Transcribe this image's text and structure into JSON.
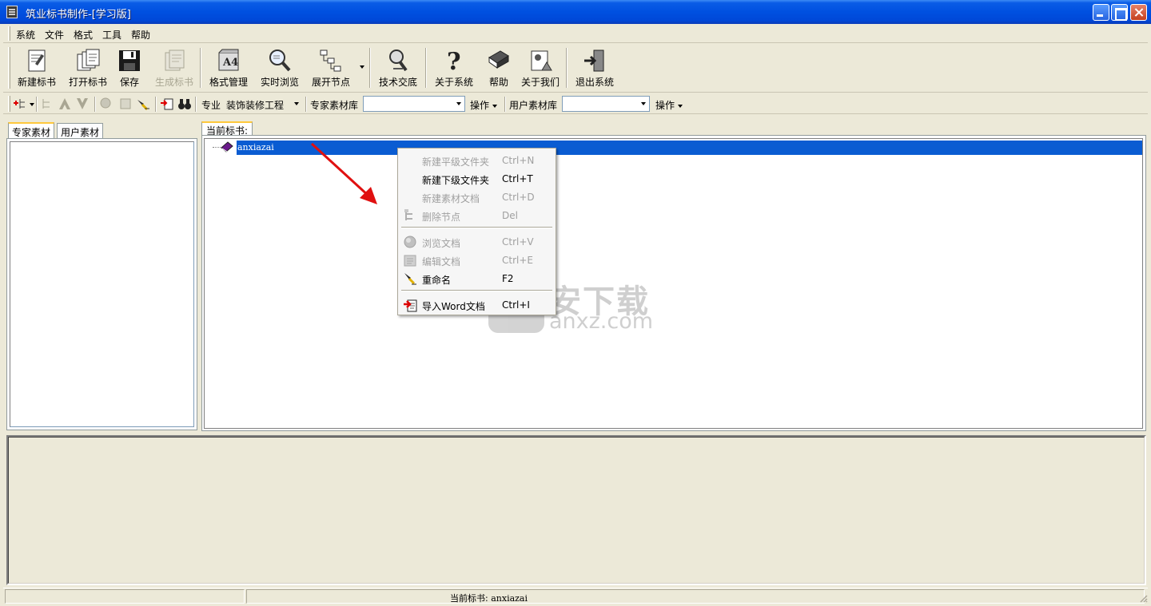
{
  "window": {
    "title": "筑业标书制作-[学习版]"
  },
  "menubar": {
    "items": [
      "系统",
      "文件",
      "格式",
      "工具",
      "帮助"
    ]
  },
  "toolbar": {
    "buttons": [
      {
        "label": "新建标书",
        "icon": "new-document-icon",
        "enabled": true
      },
      {
        "label": "打开标书",
        "icon": "open-documents-icon",
        "enabled": true
      },
      {
        "label": "保存",
        "icon": "save-floppy-icon",
        "enabled": true
      },
      {
        "label": "生成标书",
        "icon": "generate-document-icon",
        "enabled": false
      },
      {
        "label": "格式管理",
        "icon": "format-manage-icon",
        "enabled": true
      },
      {
        "label": "实时浏览",
        "icon": "magnifier-icon",
        "enabled": true
      },
      {
        "label": "展开节点",
        "icon": "tree-expand-icon",
        "enabled": true
      },
      {
        "label": "技术交底",
        "icon": "tech-search-icon",
        "enabled": true
      },
      {
        "label": "关于系统",
        "icon": "question-icon",
        "enabled": true
      },
      {
        "label": "帮助",
        "icon": "help-book-icon",
        "enabled": true
      },
      {
        "label": "关于我们",
        "icon": "about-us-icon",
        "enabled": true
      },
      {
        "label": "退出系统",
        "icon": "exit-door-icon",
        "enabled": true
      }
    ]
  },
  "toolbar2": {
    "specialty_label": "专业",
    "specialty_value": "装饰装修工程",
    "expert_lib_label": "专家素材库",
    "expert_lib_value": "",
    "operate1": "操作",
    "user_lib_label": "用户素材库",
    "user_lib_value": "",
    "operate2": "操作"
  },
  "left_panel": {
    "tabs": [
      "专家素材",
      "用户素材"
    ]
  },
  "right_panel": {
    "tab": "当前标书:",
    "tree_root": "anxiazai"
  },
  "context_menu": {
    "items": [
      {
        "label": "新建平级文件夹",
        "shortcut": "Ctrl+N",
        "enabled": false,
        "icon": ""
      },
      {
        "label": "新建下级文件夹",
        "shortcut": "Ctrl+T",
        "enabled": true,
        "icon": ""
      },
      {
        "label": "新建素材文档",
        "shortcut": "Ctrl+D",
        "enabled": false,
        "icon": ""
      },
      {
        "label": "删除节点",
        "shortcut": "Del",
        "enabled": false,
        "icon": "delete-node-icon"
      },
      {
        "label": "浏览文档",
        "shortcut": "Ctrl+V",
        "enabled": false,
        "icon": "browse-doc-icon"
      },
      {
        "label": "编辑文档",
        "shortcut": "Ctrl+E",
        "enabled": false,
        "icon": "edit-doc-icon"
      },
      {
        "label": "重命名",
        "shortcut": "F2",
        "enabled": true,
        "icon": "rename-icon"
      },
      {
        "label": "导入Word文档",
        "shortcut": "Ctrl+I",
        "enabled": true,
        "icon": "import-word-icon"
      }
    ]
  },
  "statusbar": {
    "current_label": "当前标书:",
    "current_value": "anxiazai"
  },
  "watermark": {
    "cn": "安下载",
    "en": "anxz.com"
  },
  "colors": {
    "titlebar": "#0050e0",
    "selection": "#0a5cd2",
    "arrow": "#e01010",
    "tab_accent": "#ffc83c"
  }
}
